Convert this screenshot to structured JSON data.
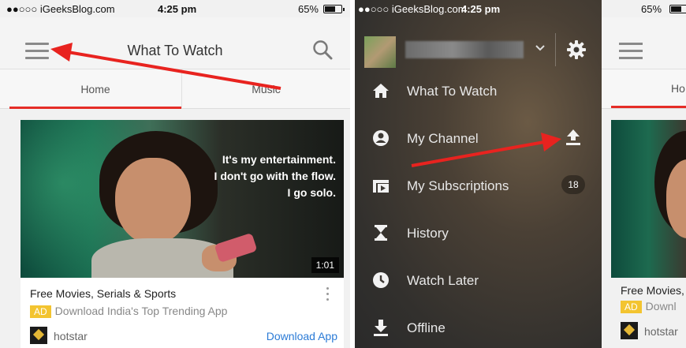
{
  "left_screen": {
    "status": {
      "carrier": "●●○○○ iGeeksBlog.com",
      "time": "4:25 pm",
      "battery": "65%",
      "battery_level": 0.65
    },
    "appbar": {
      "title": "What To Watch"
    },
    "tabs": [
      {
        "label": "Home"
      },
      {
        "label": "Music"
      }
    ],
    "card": {
      "quote_lines": [
        "It's my entertainment.",
        "I don't go with the flow.",
        "I go solo."
      ],
      "duration": "1:01",
      "title": "Free Movies, Serials & Sports",
      "ad_badge": "AD",
      "ad_text": "Download India's Top Trending App",
      "brand": "hotstar",
      "cta": "Download App"
    }
  },
  "drawer": {
    "status": {
      "carrier": "●●○○○ iGeeksBlog.com",
      "time": "4:25 pm"
    },
    "menu": [
      {
        "label": "What To Watch",
        "icon": "home-icon"
      },
      {
        "label": "My Channel",
        "icon": "account-icon"
      },
      {
        "label": "My Subscriptions",
        "icon": "subscriptions-icon",
        "badge": "18"
      },
      {
        "label": "History",
        "icon": "hourglass-icon"
      },
      {
        "label": "Watch Later",
        "icon": "clock-icon"
      },
      {
        "label": "Offline",
        "icon": "download-icon"
      }
    ]
  },
  "right_screen": {
    "status": {
      "battery": "65%"
    },
    "tab_partial": "Ho",
    "card_title_partial": "Free Movies,",
    "ad_badge": "AD",
    "ad_text_partial": "Downl",
    "brand": "hotstar"
  },
  "colors": {
    "accent_red": "#e52d27",
    "link_blue": "#2b7bd6",
    "ad_yellow": "#f3c430",
    "arrow_red": "#e8231f"
  }
}
